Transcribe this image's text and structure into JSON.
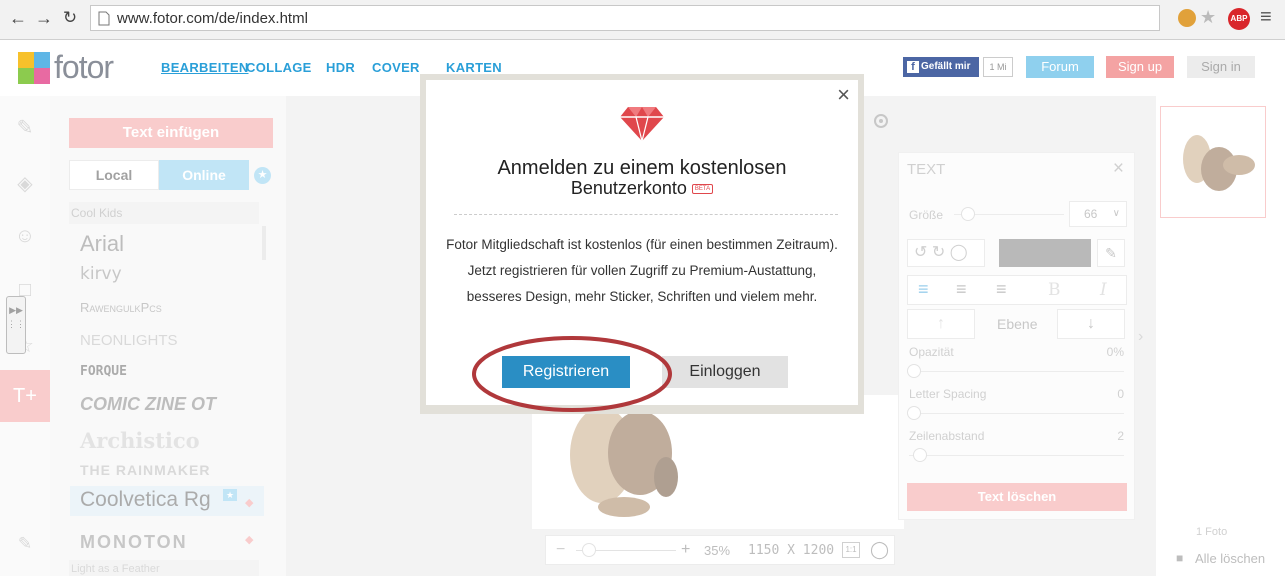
{
  "browser": {
    "url": "www.fotor.com/de/index.html",
    "abp_badge": "ABP"
  },
  "header": {
    "logo_text": "fotor",
    "nav": [
      "BEARBEITEN",
      "COLLAGE",
      "HDR",
      "COVER",
      "KARTEN"
    ],
    "like_label": "Gefällt mir",
    "like_count": "1 Mi",
    "forum": "Forum",
    "signup": "Sign up",
    "signin": "Sign in"
  },
  "panel": {
    "insert_text_button": "Text einfügen",
    "tab_local": "Local",
    "tab_online": "Online",
    "category": "Cool Kids",
    "fonts": [
      "Arial",
      "kirvy",
      "RawengulkPcs",
      "NEONLIGHTS",
      "FORQUE",
      "COMIC ZINE OT",
      "Archistico",
      "THE RAINMAKER",
      "Coolvetica Rg",
      "MONOTON"
    ],
    "next_category": "Light as a Feather"
  },
  "props": {
    "title": "TEXT",
    "size_label": "Größe",
    "size_value": "66",
    "layer_label": "Ebene",
    "opacity_label": "Opazität",
    "opacity_value": "0%",
    "letter_spacing_label": "Letter Spacing",
    "letter_spacing_value": "0",
    "line_height_label": "Zeilenabstand",
    "line_height_value": "2",
    "delete_button": "Text löschen"
  },
  "canvas_bar": {
    "zoom_percent": "35%",
    "dimensions": "1150 X 1200",
    "actual_size": "1:1"
  },
  "thumbs": {
    "count_label": "1 Foto",
    "clear_all": "Alle löschen"
  },
  "modal": {
    "title_line1": "Anmelden zu einem kostenlosen",
    "title_line2": "Benutzerkonto",
    "beta": "BETA",
    "body": "Fotor Mitgliedschaft ist kostenlos (für einen bestimmen Zeitraum). Jetzt registrieren für vollen Zugriff zu Premium-Austattung, besseres Design, mehr Sticker, Schriften und vielem mehr.",
    "register_button": "Registrieren",
    "login_button": "Einloggen"
  },
  "colors": {
    "accent_blue": "#2a9fd8",
    "pink": "#f4a3a3",
    "light_blue": "#8fd0ee",
    "highlight_ring": "#b0383b",
    "diamond": "#e0474c"
  }
}
